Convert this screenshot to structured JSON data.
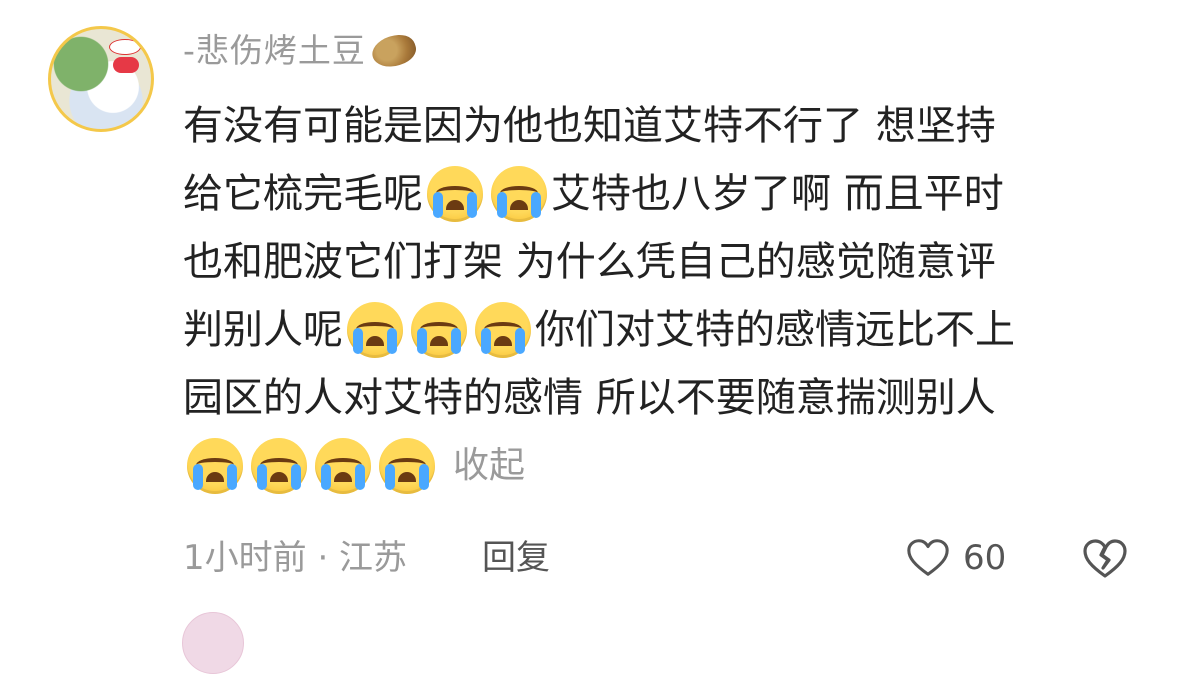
{
  "comment": {
    "username": "-悲伤烤土豆",
    "username_emoji": "potato-emoji",
    "lines": [
      {
        "segments": [
          {
            "t": "text",
            "v": "有没有可能是因为他也知道艾特不行了 想坚持"
          }
        ]
      },
      {
        "segments": [
          {
            "t": "text",
            "v": "给它梳完毛呢"
          },
          {
            "t": "emoji",
            "v": "loudly-crying-face"
          },
          {
            "t": "emoji",
            "v": "loudly-crying-face"
          },
          {
            "t": "text",
            "v": " 艾特也八岁了啊 而且平时"
          }
        ]
      },
      {
        "segments": [
          {
            "t": "text",
            "v": "也和肥波它们打架 为什么凭自己的感觉随意评"
          }
        ]
      },
      {
        "segments": [
          {
            "t": "text",
            "v": "判别人呢"
          },
          {
            "t": "emoji",
            "v": "loudly-crying-face"
          },
          {
            "t": "emoji",
            "v": "loudly-crying-face"
          },
          {
            "t": "emoji",
            "v": "loudly-crying-face"
          },
          {
            "t": "text",
            "v": "你们对艾特的感情远比不上"
          }
        ]
      },
      {
        "segments": [
          {
            "t": "text",
            "v": "园区的人对艾特的感情 所以不要随意揣测别人"
          }
        ]
      },
      {
        "segments": [
          {
            "t": "emoji",
            "v": "loudly-crying-face"
          },
          {
            "t": "emoji",
            "v": "loudly-crying-face"
          },
          {
            "t": "emoji",
            "v": "loudly-crying-face"
          },
          {
            "t": "emoji",
            "v": "loudly-crying-face"
          },
          {
            "t": "collapse",
            "v": "收起"
          }
        ]
      }
    ],
    "time_location": "1小时前 · 江苏",
    "reply_label": "回复",
    "like_count": "60"
  },
  "colors": {
    "text": "#222222",
    "muted": "#9a9a9a",
    "accent_tear": "#4aa8ff"
  }
}
